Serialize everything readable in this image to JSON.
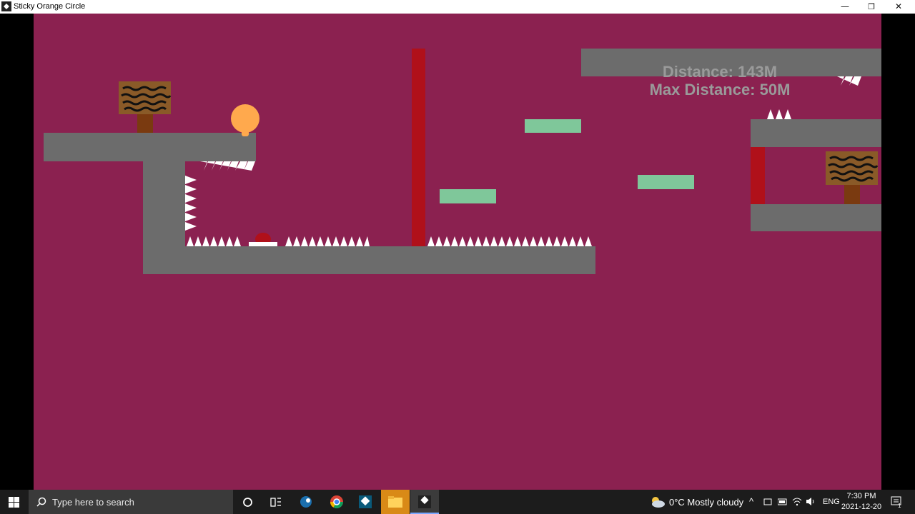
{
  "window": {
    "title": "Sticky Orange Circle",
    "minimize": "—",
    "maximize": "❐",
    "close": "✕"
  },
  "hud": {
    "distance": "Distance: 143M",
    "max_distance": "Max Distance: 50M"
  },
  "colors": {
    "background": "#8b2150",
    "platform": "#6c6c6c",
    "moving_platform": "#7fc79a",
    "hazard_wall": "#b0101a",
    "player": "#ffa94d",
    "spike": "#ffffff"
  },
  "taskbar": {
    "search_placeholder": "Type here to search",
    "weather": "0°C  Mostly cloudy",
    "language": "ENG",
    "time": "7:30 PM",
    "date": "2021-12-20",
    "notification_count": "1"
  }
}
